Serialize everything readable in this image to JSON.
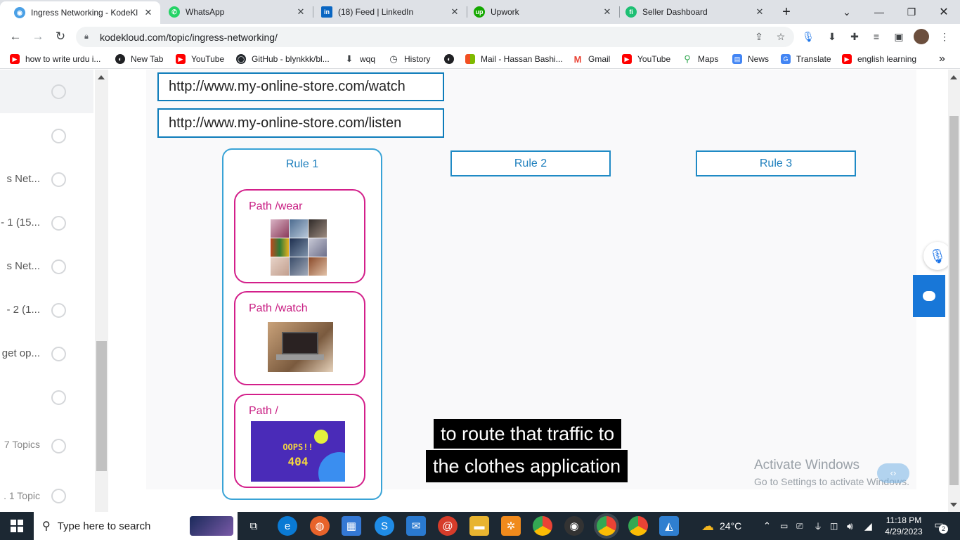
{
  "browser": {
    "tabs": [
      {
        "label": "Ingress Networking - KodeKl",
        "icon": "kodekloud-icon",
        "color": "#4aa0e6",
        "active": true
      },
      {
        "label": "WhatsApp",
        "icon": "whatsapp-icon",
        "color": "#25d366",
        "active": false
      },
      {
        "label": "(18) Feed | LinkedIn",
        "icon": "linkedin-icon",
        "color": "#0a66c2",
        "active": false
      },
      {
        "label": "Upwork",
        "icon": "upwork-icon",
        "color": "#14a800",
        "active": false
      },
      {
        "label": "Seller Dashboard",
        "icon": "fiverr-icon",
        "color": "#1dbf73",
        "active": false
      }
    ],
    "new_tab_symbol": "+",
    "url": "kodekloud.com/topic/ingress-networking/",
    "bookmarks": [
      {
        "label": "how to write urdu i...",
        "icon": "youtube-icon"
      },
      {
        "label": "New Tab",
        "icon": "globe-icon"
      },
      {
        "label": "YouTube",
        "icon": "youtube-icon"
      },
      {
        "label": "GitHub - blynkkk/bl...",
        "icon": "github-icon"
      },
      {
        "label": "wqq",
        "icon": "download-icon"
      },
      {
        "label": "History",
        "icon": "history-icon"
      },
      {
        "label": "",
        "icon": "globe-icon"
      },
      {
        "label": "Mail - Hassan Bashi...",
        "icon": "microsoft-icon"
      },
      {
        "label": "Gmail",
        "icon": "gmail-icon"
      },
      {
        "label": "YouTube",
        "icon": "youtube-icon"
      },
      {
        "label": "Maps",
        "icon": "maps-icon"
      },
      {
        "label": "News",
        "icon": "news-icon"
      },
      {
        "label": "Translate",
        "icon": "translate-icon"
      },
      {
        "label": "english learning",
        "icon": "youtube-icon"
      }
    ],
    "more_bookmarks": "»"
  },
  "sidebar": {
    "items": [
      {
        "text": ""
      },
      {
        "text": ""
      },
      {
        "text": "s Net..."
      },
      {
        "text": "- 1 (15..."
      },
      {
        "text": "s Net..."
      },
      {
        "text": "- 2 (1..."
      },
      {
        "text": "get op..."
      },
      {
        "text": ""
      },
      {
        "text": "7 Topics"
      },
      {
        "text": ". 1 Topic"
      }
    ]
  },
  "slide": {
    "urls": [
      "http://www.my-online-store.com/watch",
      "http://www.my-online-store.com/listen"
    ],
    "rules": [
      "Rule 1",
      "Rule 2",
      "Rule 3"
    ],
    "paths": [
      "Path /wear",
      "Path /watch",
      "Path /"
    ],
    "oops_text": "OOPS!!",
    "error_code": "404",
    "captions": [
      "to route that traffic to",
      "the clothes application"
    ]
  },
  "watermark": {
    "line1": "Activate Windows",
    "line2": "Go to Settings to activate Windows."
  },
  "taskbar": {
    "search_placeholder": "Type here to search",
    "temperature": "24°C",
    "time": "11:18 PM",
    "date": "4/29/2023",
    "notification_count": "2"
  },
  "colors": {
    "accent_blue": "#1e7fbd",
    "path_pink": "#d31f8a",
    "chat_blue": "#1877d8",
    "taskbar": "#1c2833"
  }
}
